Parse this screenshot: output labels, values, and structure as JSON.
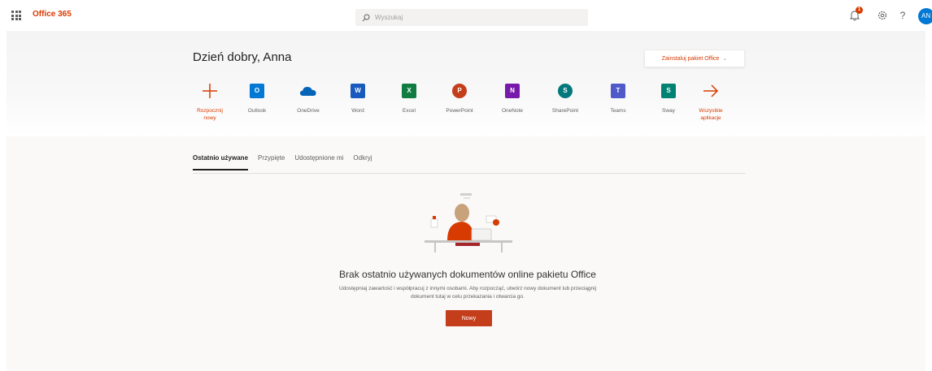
{
  "brand": {
    "name": "Office 365",
    "color": "#d83b01"
  },
  "search": {
    "placeholder": "Wyszukaj",
    "icon": "search-icon"
  },
  "header_icons": {
    "notifications": {
      "icon": "bell-icon",
      "badge": "1"
    },
    "settings": {
      "icon": "gear-icon"
    },
    "help": {
      "icon": "help-icon",
      "glyph": "?"
    },
    "avatar": {
      "initials": "AN"
    }
  },
  "greeting": "Dzień dobry, Anna",
  "install_button": {
    "label": "Zainstaluj pakiet Office",
    "icon": "chevron-down-icon"
  },
  "apps": [
    {
      "label_line1": "Rozpocznij",
      "label_line2": "nowy",
      "icon": "plus-icon",
      "accent": true
    },
    {
      "label_line1": "Outlook",
      "label_line2": "",
      "icon": "outlook-icon",
      "color": "#0078d4"
    },
    {
      "label_line1": "OneDrive",
      "label_line2": "",
      "icon": "onedrive-icon",
      "color": "#0364b8"
    },
    {
      "label_line1": "Word",
      "label_line2": "",
      "icon": "word-icon",
      "color": "#185abd"
    },
    {
      "label_line1": "Excel",
      "label_line2": "",
      "icon": "excel-icon",
      "color": "#107c41"
    },
    {
      "label_line1": "PowerPoint",
      "label_line2": "",
      "icon": "powerpoint-icon",
      "color": "#c43e1c"
    },
    {
      "label_line1": "OneNote",
      "label_line2": "",
      "icon": "onenote-icon",
      "color": "#7719aa"
    },
    {
      "label_line1": "SharePoint",
      "label_line2": "",
      "icon": "sharepoint-icon",
      "color": "#03787c"
    },
    {
      "label_line1": "Teams",
      "label_line2": "",
      "icon": "teams-icon",
      "color": "#5059c9"
    },
    {
      "label_line1": "Sway",
      "label_line2": "",
      "icon": "sway-icon",
      "color": "#008272"
    },
    {
      "label_line1": "Wszystkie",
      "label_line2": "aplikacje",
      "icon": "arrow-right-icon",
      "accent": true
    }
  ],
  "tabs": [
    {
      "label": "Ostatnio używane",
      "active": true
    },
    {
      "label": "Przypięte",
      "active": false
    },
    {
      "label": "Udostępnione mi",
      "active": false
    },
    {
      "label": "Odkryj",
      "active": false
    }
  ],
  "empty_state": {
    "title": "Brak ostatnio używanych dokumentów online pakietu Office",
    "description": "Udostępniaj zawartość i współpracuj z innymi osobami. Aby rozpocząć, utwórz nowy dokument lub przeciągnij dokument tutaj w celu przekazania i otwarcia go.",
    "button_label": "Nowy",
    "button_color": "#c43e1c"
  }
}
